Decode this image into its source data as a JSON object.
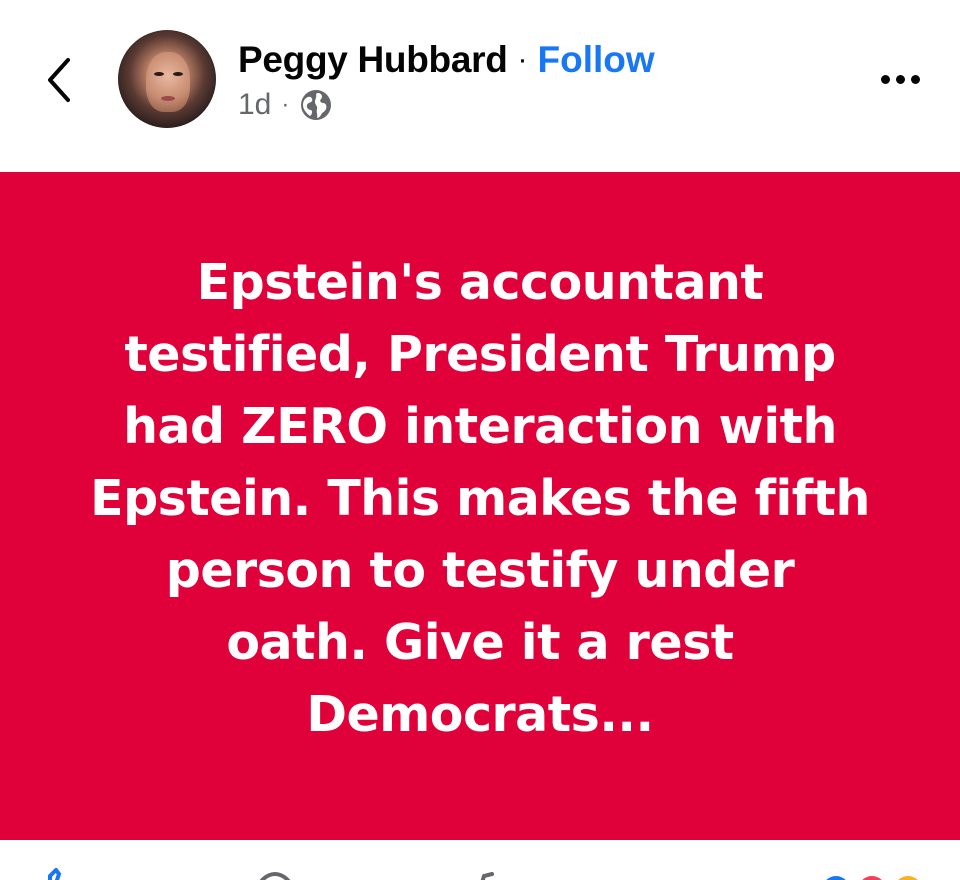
{
  "header": {
    "back_icon": "chevron-left-icon",
    "author_name": "Peggy Hubbard",
    "separator": "·",
    "follow_label": "Follow",
    "timestamp": "1d",
    "meta_separator": "·",
    "privacy_icon": "globe-icon",
    "more_icon": "more-horizontal-icon"
  },
  "post": {
    "background_color": "#e0003a",
    "text_lines": [
      "Epstein's accountant",
      "testified, President Trump",
      "had ZERO interaction with",
      "Epstein. This makes the fifth",
      "person to testify under",
      "oath. Give it a rest",
      "Democrats..."
    ]
  },
  "actions": {
    "icons": [
      "like-icon",
      "comment-icon",
      "share-icon",
      "reactions-icon"
    ]
  },
  "colors": {
    "accent": "#1877f2",
    "meta_text": "#65676b",
    "post_background": "#e0003a"
  }
}
